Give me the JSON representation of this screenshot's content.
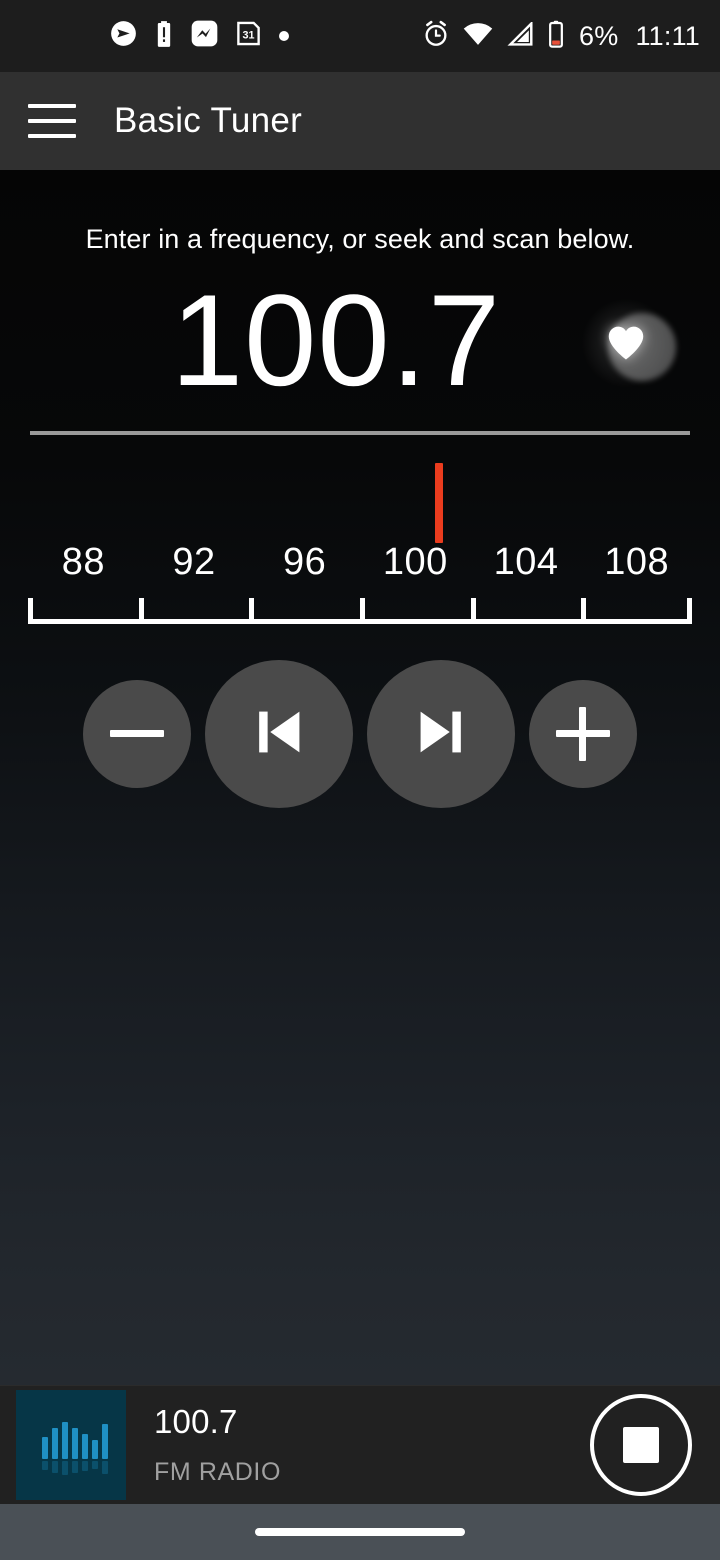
{
  "status_bar": {
    "icons_left": [
      {
        "name": "send-icon",
        "label": "send"
      },
      {
        "name": "battery-alert-icon",
        "label": "battery alert"
      },
      {
        "name": "messenger-icon",
        "label": "messenger"
      },
      {
        "name": "calendar-icon",
        "label": "31"
      },
      {
        "name": "notification-dot-icon",
        "label": "dot"
      }
    ],
    "calendar_day": "31",
    "icons_right": [
      {
        "name": "alarm-icon",
        "label": "alarm"
      },
      {
        "name": "wifi-icon",
        "label": "wifi"
      },
      {
        "name": "cellular-signal-icon",
        "label": "signal"
      },
      {
        "name": "battery-icon",
        "label": "battery"
      }
    ],
    "battery_percent": "6%",
    "time": "11:11",
    "battery_color": "#e8503a"
  },
  "app_bar": {
    "menu_icon": "hamburger-menu-icon",
    "title": "Basic Tuner"
  },
  "tuner": {
    "hint": "Enter in a frequency, or seek and scan below.",
    "frequency": "100.7",
    "favorite_icon": "heart-icon",
    "favorite_active": true,
    "needle_color": "#eb3c1e",
    "scale": {
      "labels": [
        "88",
        "92",
        "96",
        "100",
        "104",
        "108"
      ],
      "min": 86,
      "max": 110,
      "current": 100.7
    },
    "controls": [
      {
        "name": "frequency-decrease-button",
        "icon": "minus-icon",
        "size": "small"
      },
      {
        "name": "seek-previous-button",
        "icon": "skip-previous-icon",
        "size": "large"
      },
      {
        "name": "seek-next-button",
        "icon": "skip-next-icon",
        "size": "large"
      },
      {
        "name": "frequency-increase-button",
        "icon": "plus-icon",
        "size": "small"
      }
    ]
  },
  "now_playing": {
    "artwork_icon": "equalizer-bars-icon",
    "artwork_bg": "#063647",
    "artwork_bar_color": "#1f90c4",
    "title": "100.7",
    "subtitle": "FM RADIO",
    "stop_icon": "stop-icon"
  },
  "nav_bar": {
    "gesture_pill": "home-gesture-pill"
  }
}
